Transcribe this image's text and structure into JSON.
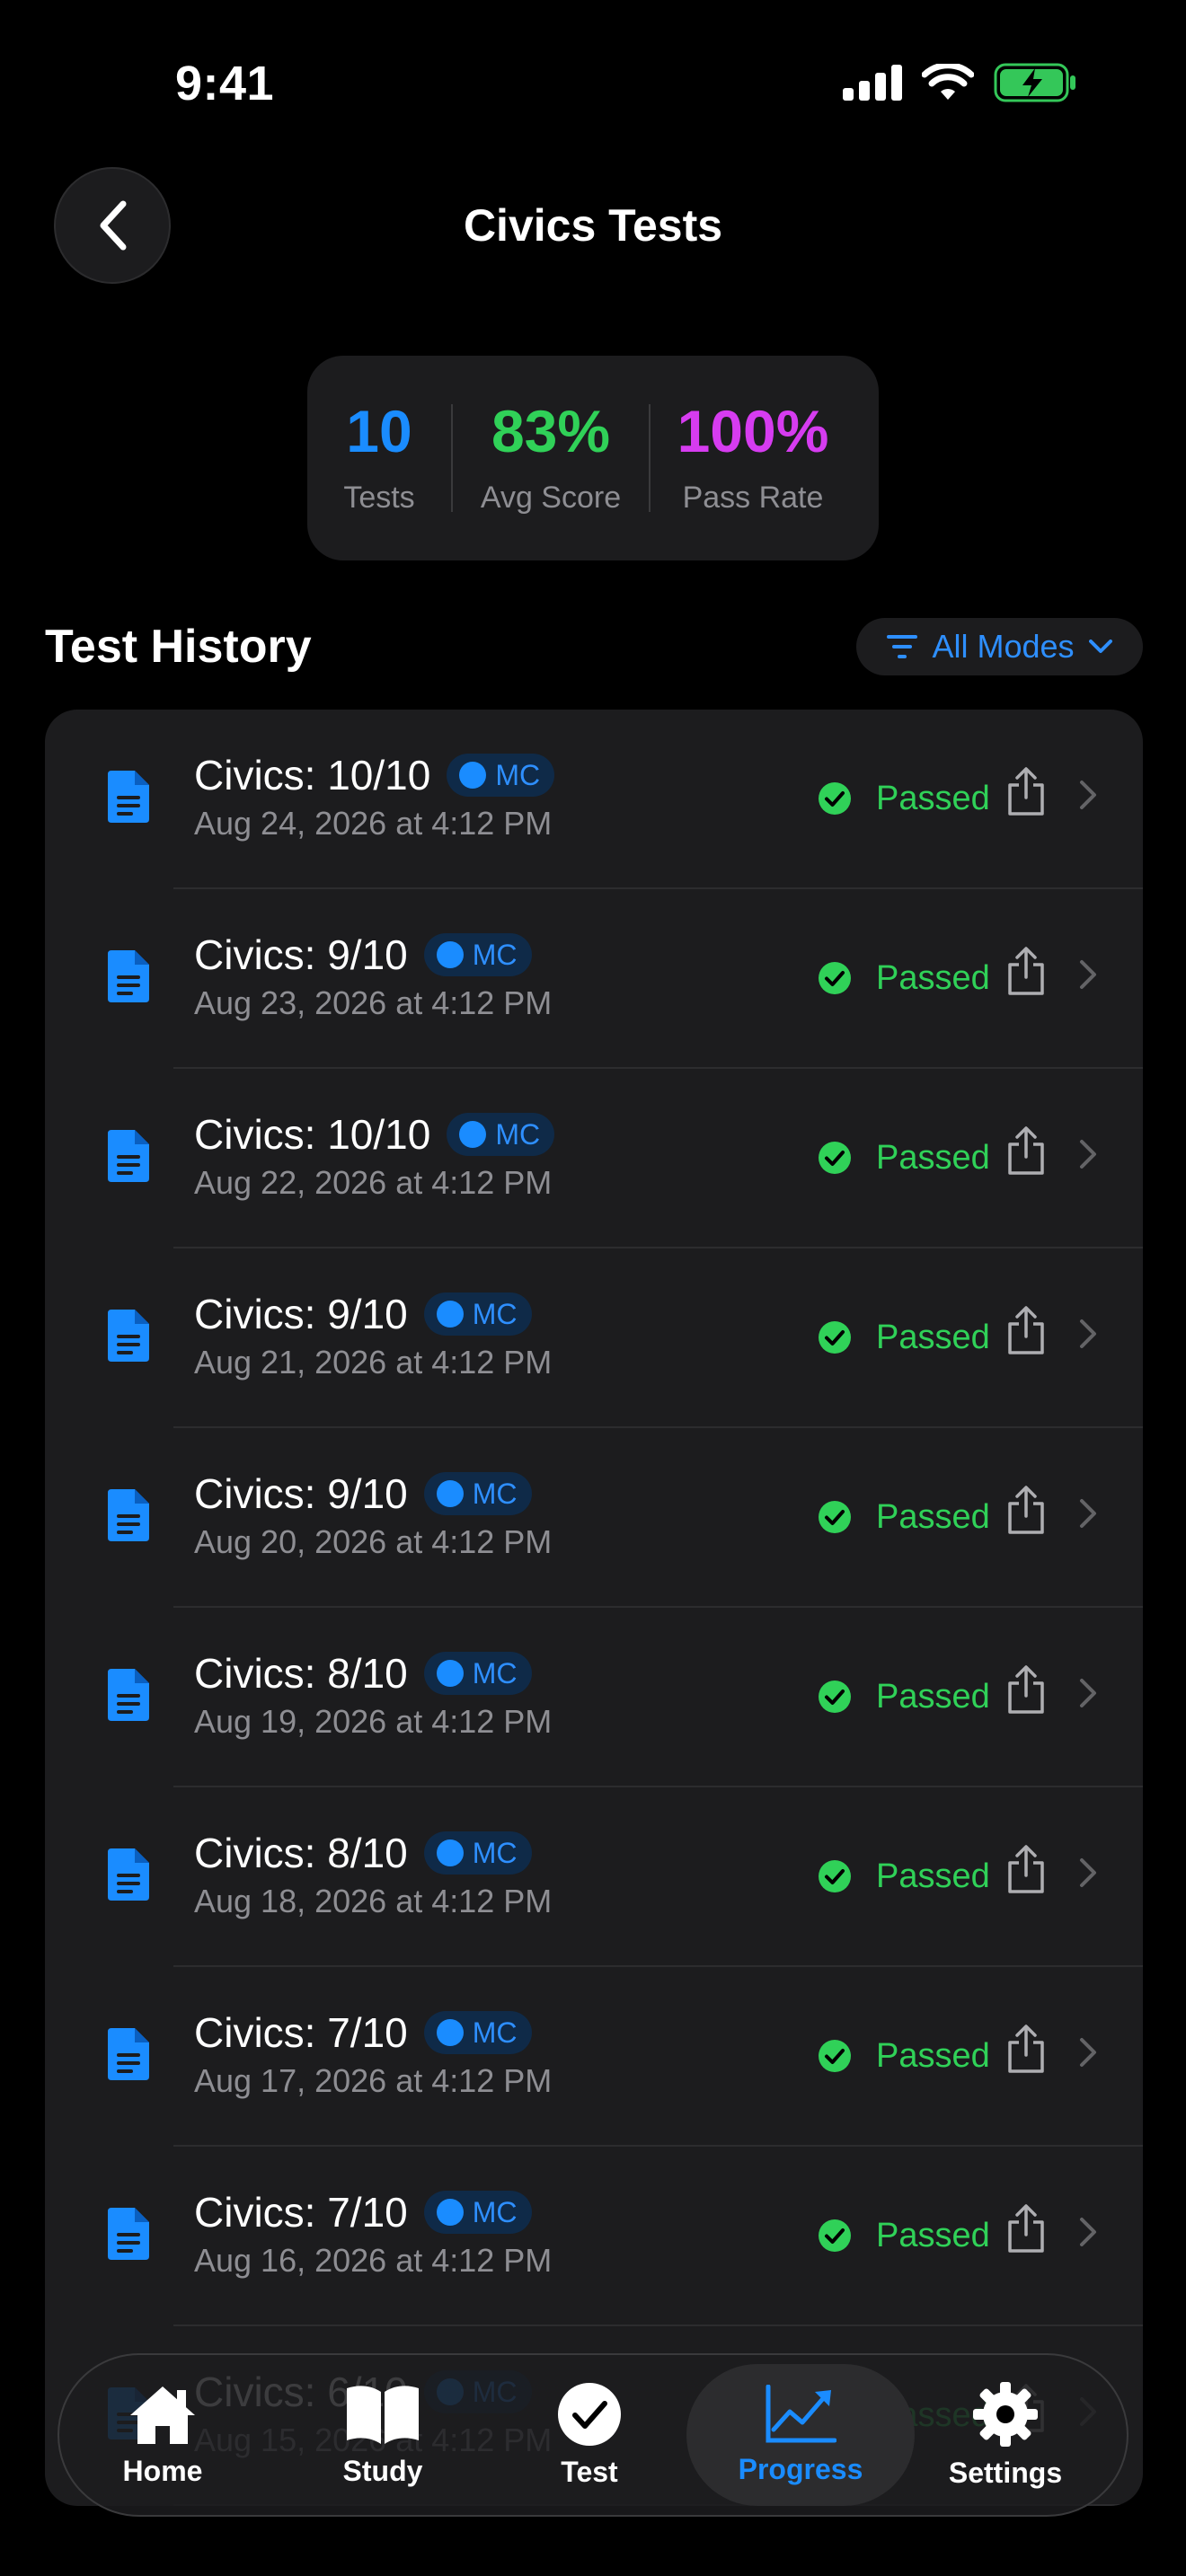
{
  "status_bar": {
    "time": "9:41"
  },
  "header": {
    "title": "Civics Tests"
  },
  "stats": [
    {
      "value": "10",
      "label": "Tests",
      "color": "#1a8cff"
    },
    {
      "value": "83%",
      "label": "Avg Score",
      "color": "#30d158"
    },
    {
      "value": "100%",
      "label": "Pass Rate",
      "color": "#d63cf0"
    }
  ],
  "history": {
    "title": "Test History",
    "filter_label": "All Modes",
    "items": [
      {
        "title": "Civics: 10/10",
        "mode": "MC",
        "date": "Aug 24, 2026 at 4:12 PM",
        "status": "Passed"
      },
      {
        "title": "Civics: 9/10",
        "mode": "MC",
        "date": "Aug 23, 2026 at 4:12 PM",
        "status": "Passed"
      },
      {
        "title": "Civics: 10/10",
        "mode": "MC",
        "date": "Aug 22, 2026 at 4:12 PM",
        "status": "Passed"
      },
      {
        "title": "Civics: 9/10",
        "mode": "MC",
        "date": "Aug 21, 2026 at 4:12 PM",
        "status": "Passed"
      },
      {
        "title": "Civics: 9/10",
        "mode": "MC",
        "date": "Aug 20, 2026 at 4:12 PM",
        "status": "Passed"
      },
      {
        "title": "Civics: 8/10",
        "mode": "MC",
        "date": "Aug 19, 2026 at 4:12 PM",
        "status": "Passed"
      },
      {
        "title": "Civics: 8/10",
        "mode": "MC",
        "date": "Aug 18, 2026 at 4:12 PM",
        "status": "Passed"
      },
      {
        "title": "Civics: 7/10",
        "mode": "MC",
        "date": "Aug 17, 2026 at 4:12 PM",
        "status": "Passed"
      },
      {
        "title": "Civics: 7/10",
        "mode": "MC",
        "date": "Aug 16, 2026 at 4:12 PM",
        "status": "Passed"
      },
      {
        "title": "Civics: 6/10",
        "mode": "MC",
        "date": "Aug 15, 2026 at 4:12 PM",
        "status": "Passed"
      }
    ]
  },
  "tabbar": {
    "tabs": [
      {
        "label": "Home",
        "icon": "house-icon"
      },
      {
        "label": "Study",
        "icon": "book-icon"
      },
      {
        "label": "Test",
        "icon": "checkmark-circle-icon"
      },
      {
        "label": "Progress",
        "icon": "chart-line-icon",
        "active": true
      },
      {
        "label": "Settings",
        "icon": "gear-icon"
      }
    ]
  }
}
